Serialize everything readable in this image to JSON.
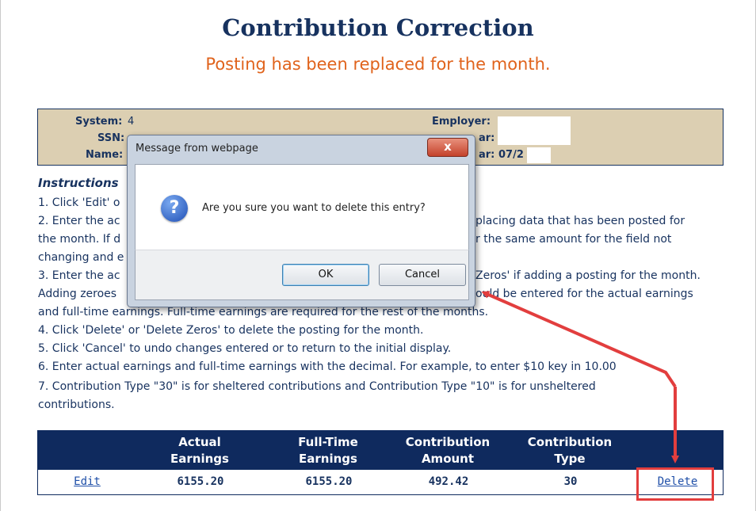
{
  "page": {
    "title": "Contribution Correction",
    "subtitle": "Posting has been replaced for the month."
  },
  "info": {
    "system_label": "System:",
    "system_value": "4",
    "ssn_label": "SSN:",
    "name_label": "Name:",
    "employer_label": "Employer:",
    "year_label_suffix": "ar:",
    "period_label_suffix": "ar:",
    "period_value": "07/2"
  },
  "instructions": {
    "title": "Instructions",
    "lines": [
      "1. Click 'Edit' o",
      "2. Enter the ac",
      "the month. If d",
      "changing and e",
      "3. Enter the ac",
      "Adding zeroes",
      "and full-time earnings. Full-time earnings are required for the rest of the months.",
      "4. Click 'Delete' or 'Delete Zeros' to delete the posting for the month.",
      "5. Click 'Cancel' to undo changes entered or to return to the initial display.",
      "6. Enter actual earnings and full-time earnings with the decimal. For example, to enter $10 key in 10.00",
      "7. Contribution Type \"30\" is for sheltered contributions and Contribution Type \"10\" is for unsheltered",
      "contributions."
    ],
    "right_fragments": [
      "placing data that has been posted for",
      "r the same amount for the field not",
      "Zeros' if adding a posting for the month.",
      "ould be entered for the actual earnings"
    ]
  },
  "table": {
    "headers": [
      "Actual\nEarnings",
      "Full-Time\nEarnings",
      "Contribution\nAmount",
      "Contribution\nType"
    ],
    "header_lines": [
      [
        "Actual",
        "Earnings"
      ],
      [
        "Full-Time",
        "Earnings"
      ],
      [
        "Contribution",
        "Amount"
      ],
      [
        "Contribution",
        "Type"
      ]
    ],
    "row": {
      "edit_label": "Edit",
      "actual_earnings": "6155.20",
      "full_time_earnings": "6155.20",
      "contribution_amount": "492.42",
      "contribution_type": "30",
      "delete_label": "Delete"
    }
  },
  "dialog": {
    "title": "Message from webpage",
    "close_glyph": "x",
    "icon": "question-icon",
    "message": "Are you sure you want to delete this entry?",
    "ok_label": "OK",
    "cancel_label": "Cancel"
  },
  "colors": {
    "navy": "#17325f",
    "header_bg": "#0f2a5e",
    "subtitle": "#e0631c",
    "info_bg": "#dccfb2",
    "annotation_red": "#e23e3e"
  }
}
